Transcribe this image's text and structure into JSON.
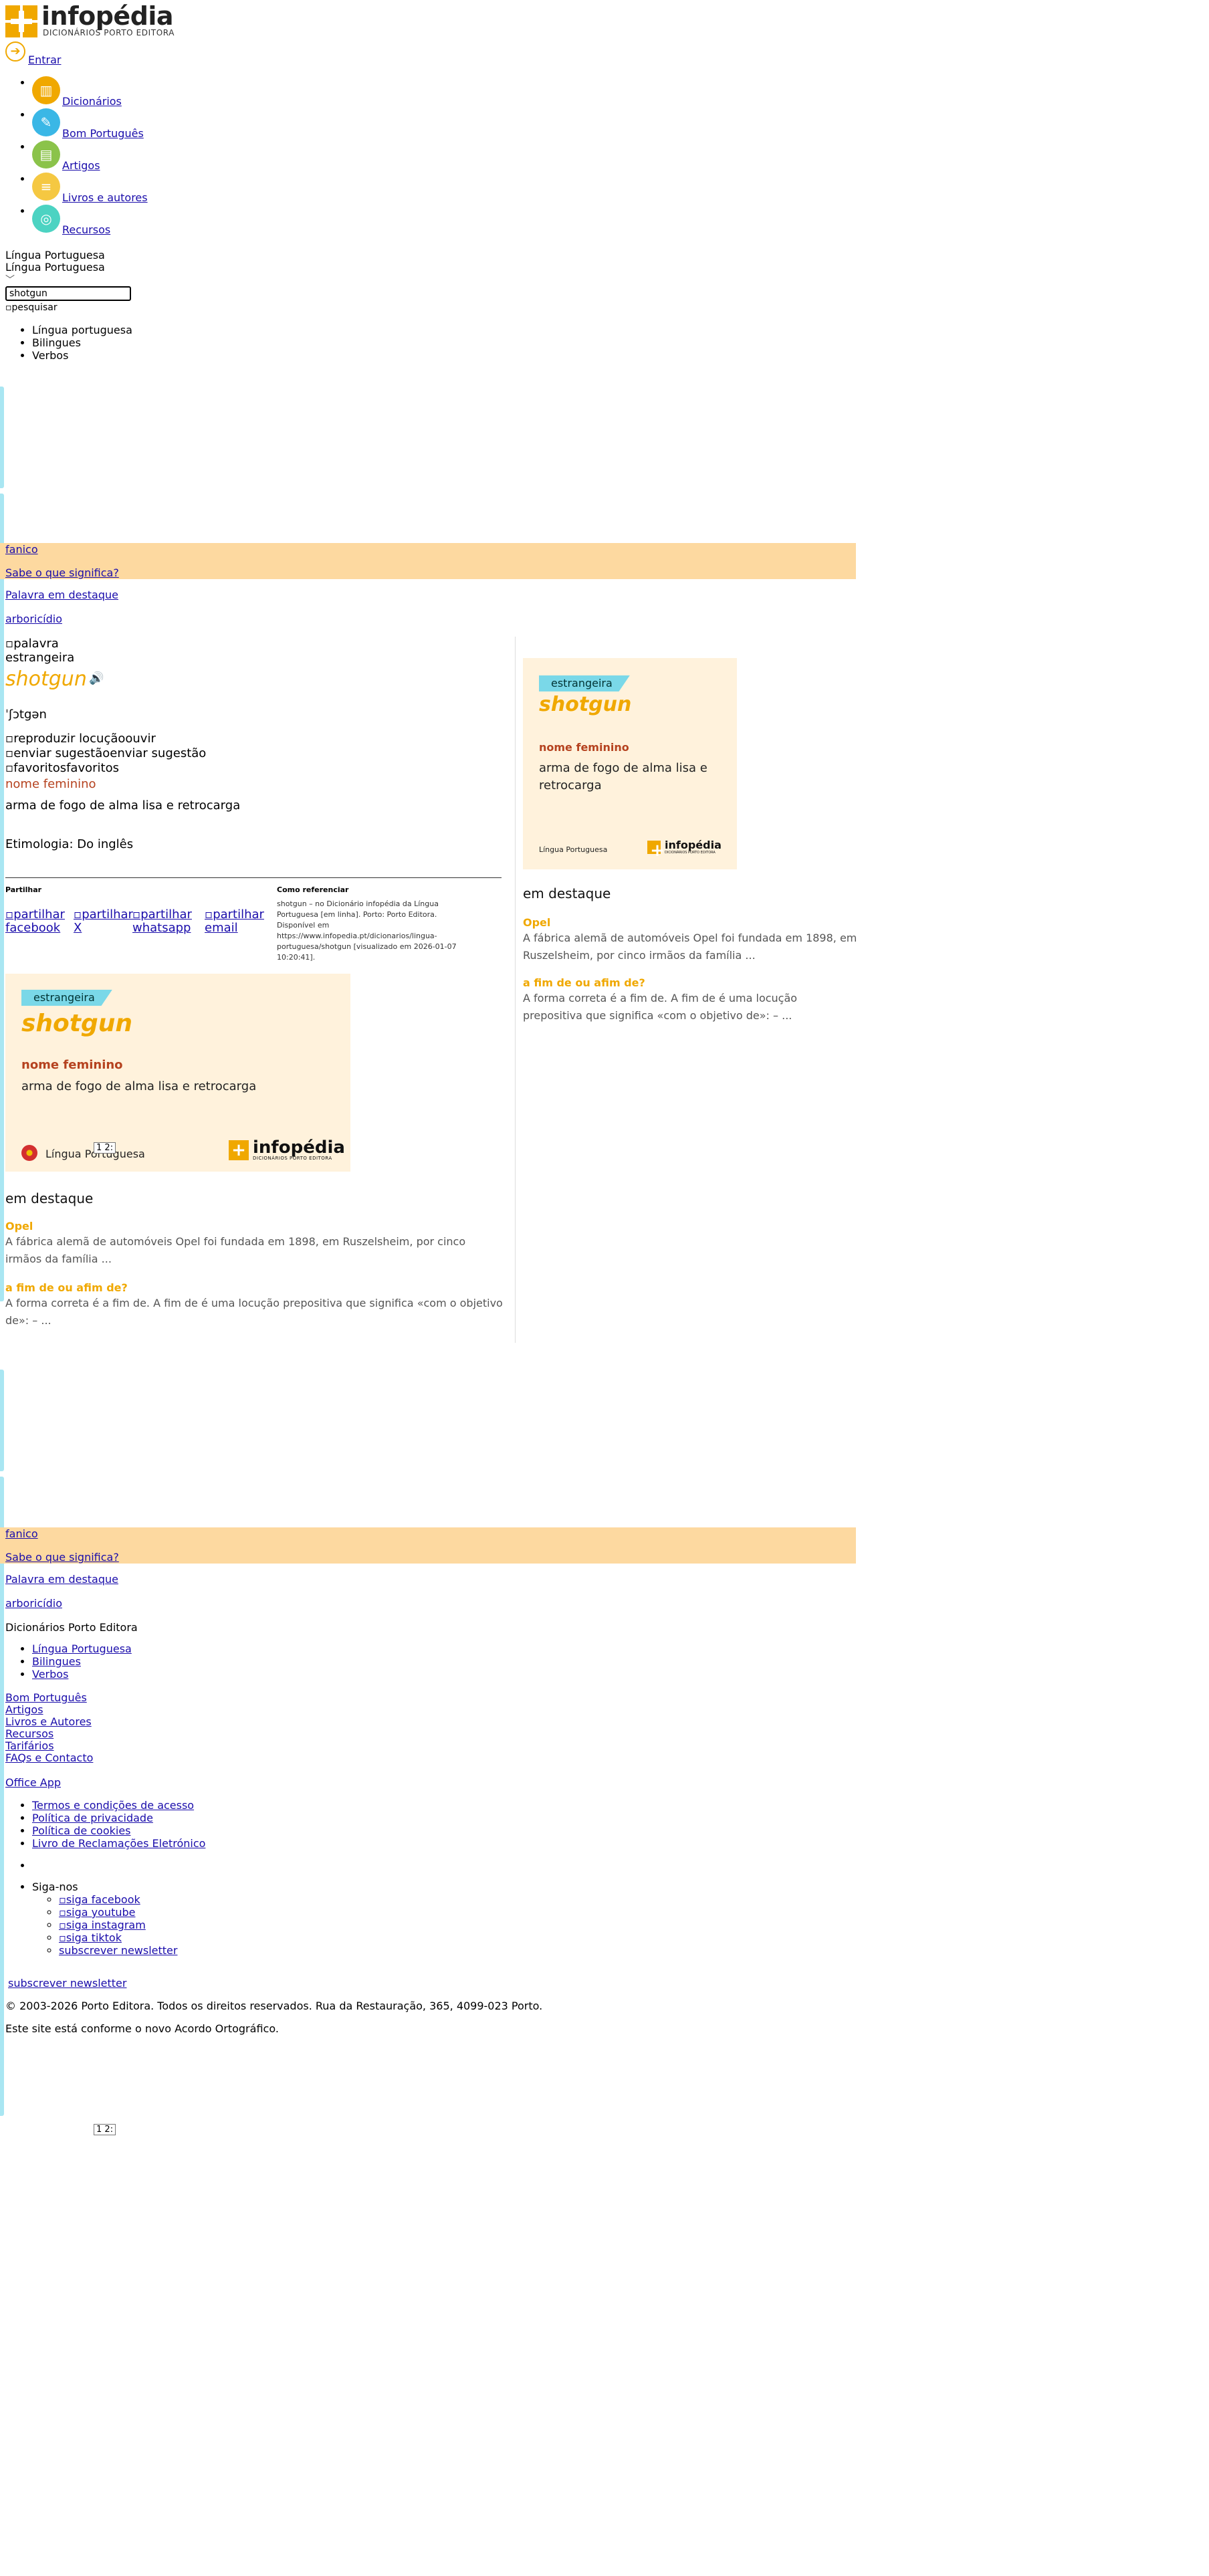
{
  "header": {
    "logo_text": "infopédia",
    "logo_sub": "DICIONÁRIOS PORTO EDITORA",
    "login_label": "Entrar"
  },
  "nav": [
    {
      "label": "Dicionários",
      "color": "#f0a800",
      "icon": "book-icon"
    },
    {
      "label": "Bom Português",
      "color": "#3ab7e6",
      "icon": "quill-icon"
    },
    {
      "label": "Artigos",
      "color": "#8bc34a",
      "icon": "document-icon"
    },
    {
      "label": "Livros e autores",
      "color": "#f5c842",
      "icon": "books-icon"
    },
    {
      "label": "Recursos",
      "color": "#4cd3c2",
      "icon": "resources-icon"
    }
  ],
  "search": {
    "language_selected": "Língua Portuguesa",
    "language_selected_repeat": "Língua Portuguesa",
    "value": "shotgun",
    "button_alt": "pesquisar",
    "scopes": [
      "Língua portuguesa",
      "Bilingues",
      "Verbos"
    ]
  },
  "band": {
    "word": "fanico",
    "question": "Sabe o que significa?",
    "featured_label": "Palavra em destaque",
    "featured_word": "arboricídio"
  },
  "entry": {
    "img_alt": "palavra estrangeira",
    "word": "shotgun",
    "phonetic": "ˈʃɔtgən",
    "play_audio": "reproduzir locuçãoouvir",
    "suggest": "enviar sugestãoenviar sugestão",
    "favorites": "favoritosfavoritos",
    "gram": "nome feminino",
    "definition": "arma de fogo de alma lisa e retrocarga",
    "etymology": "Etimologia: Do inglês"
  },
  "share": {
    "title": "Partilhar",
    "items": [
      "partilhar facebook",
      "partilhar X",
      "partilhar whatsapp",
      "partilhar email"
    ]
  },
  "reference": {
    "title": "Como referenciar",
    "text": "shotgun – no Dicionário infopédia da Língua Portuguesa [em linha]. Porto: Porto Editora. Disponível em https://www.infopedia.pt/dicionarios/lingua-portuguesa/shotgun [visualizado em 2026-01-07 10:20:41]."
  },
  "card": {
    "tag": "estrangeira",
    "word": "shotgun",
    "gram": "nome feminino",
    "definition": "arma de fogo de alma lisa e retrocarga",
    "lang": "Língua Portuguesa",
    "brand": "infopédia",
    "brand_sub": "DICIONÁRIOS PORTO EDITORA"
  },
  "featured": {
    "heading": "em destaque",
    "items": [
      {
        "title": "Opel",
        "desc": "A fábrica alemã de automóveis Opel foi fundada em 1898, em Ruszelsheim, por cinco irmãos da família ..."
      },
      {
        "title": "a fim de ou afim de?",
        "desc": "A forma correta é a fim de. A fim de é uma locução prepositiva que significa «com o objetivo de»: – ..."
      }
    ]
  },
  "pager": [
    "1",
    "2",
    ":"
  ],
  "footer": {
    "brand": "Dicionários Porto Editora",
    "dict_links": [
      "Língua Portuguesa",
      "Bilingues",
      "Verbos"
    ],
    "links": [
      "Bom Português",
      "Artigos",
      "Livros e Autores",
      "Recursos",
      "Tarifários",
      "FAQs e Contacto"
    ],
    "office": "Office App",
    "legal": [
      "Termos e condições de acesso",
      "Política de privacidade",
      "Política de cookies",
      "Livro de Reclamações Eletrónico"
    ],
    "follow": "Siga-nos",
    "social": [
      "siga facebook",
      "siga youtube",
      "siga instagram",
      "siga tiktok"
    ],
    "newsletter": "subscrever newsletter",
    "newsletter2": "subscrever newsletter",
    "copyright": "© 2003-2026 Porto Editora. Todos os direitos reservados. Rua da Restauração, 365, 4099-023 Porto.",
    "agreement": "Este site está conforme o novo Acordo Ortográfico."
  }
}
